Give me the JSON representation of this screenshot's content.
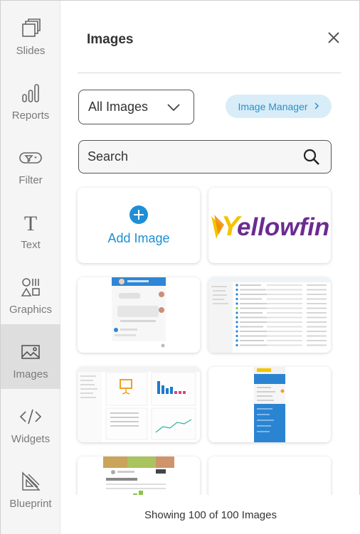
{
  "sidebar": {
    "items": [
      {
        "label": "Slides",
        "icon": "slides-icon"
      },
      {
        "label": "Reports",
        "icon": "reports-icon"
      },
      {
        "label": "Filter",
        "icon": "filter-icon"
      },
      {
        "label": "Text",
        "icon": "text-icon"
      },
      {
        "label": "Graphics",
        "icon": "graphics-icon"
      },
      {
        "label": "Images",
        "icon": "images-icon",
        "active": true
      },
      {
        "label": "Widgets",
        "icon": "widgets-icon"
      },
      {
        "label": "Blueprint",
        "icon": "blueprint-icon"
      }
    ]
  },
  "panel": {
    "title": "Images",
    "filter_value": "All Images",
    "manager_label": "Image Manager",
    "search_placeholder": "Search",
    "add_image_label": "Add Image",
    "logo_text_y": "Y",
    "logo_text_rest": "ellowfin",
    "footer": "Showing 100 of 100 Images"
  },
  "colors": {
    "accent": "#1e8fd6",
    "manager_bg": "#d8edf8",
    "sidebar_bg": "#f5f5f5",
    "sidebar_active": "#dedede",
    "logo_yellow": "#f4c400",
    "logo_purple": "#6a2c91"
  }
}
